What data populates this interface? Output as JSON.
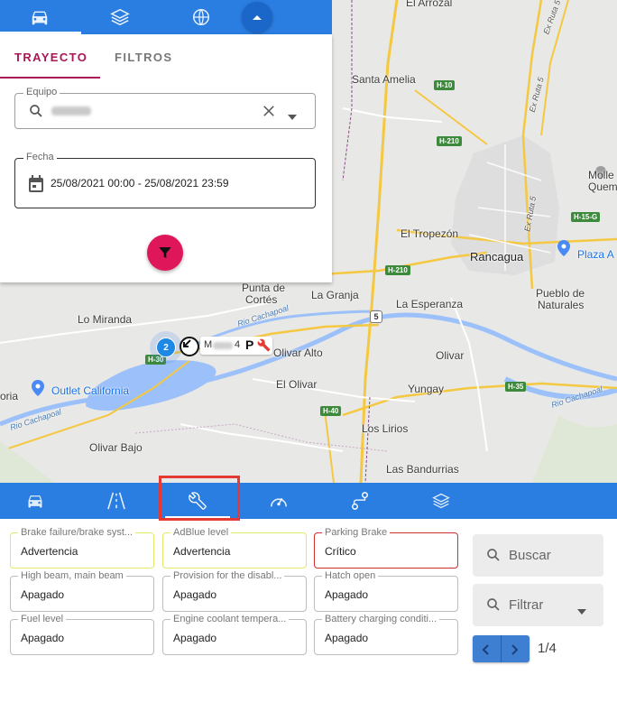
{
  "map": {
    "labels": {
      "el_arrozal": "El Arrozal",
      "santa_amelia": "Santa Amelia",
      "el_tropezon": "El Tropezón",
      "rancagua": "Rancagua",
      "plaza": "Plaza A",
      "punta_cortes_1": "Punta de",
      "punta_cortes_2": "Cortés",
      "la_granja": "La Granja",
      "la_esperanza": "La Esperanza",
      "pueblo_1": "Pueblo de",
      "pueblo_2": "Naturales",
      "lo_miranda": "Lo Miranda",
      "olivar_alto": "Olivar Alto",
      "olivar": "Olivar",
      "outlet": "Outlet California",
      "el_olivar": "El Olivar",
      "yungay": "Yungay",
      "los_lirios": "Los Lirios",
      "olivar_bajo": "Olivar Bajo",
      "las_bandurrias": "Las Bandurrias",
      "oria": "oria",
      "molle_1": "Molle",
      "molle_2": "Quem",
      "rio_1": "Rio Cachapoal",
      "rio_2": "Rio Cachapoal",
      "rio_3": "Rio Cachapoal",
      "ruta5_1": "Ex Ruta 5",
      "ruta5_2": "Ex Ruta 5",
      "ruta5_3": "Ex Ruta 5"
    },
    "shields": {
      "h10": "H-10",
      "h210a": "H-210",
      "h210b": "H-210",
      "h15g": "H-15-G",
      "h30": "H-30",
      "h40": "H-40",
      "h35": "H-35",
      "r5": "5"
    },
    "cluster_count": "2",
    "vehicle_label_suffix": "4",
    "vehicle_p": "P"
  },
  "panel": {
    "tabs": [
      "TRAYECTO",
      "FILTROS"
    ],
    "equipo_label": "Equipo",
    "fecha_label": "Fecha",
    "fecha_value": "25/08/2021 00:00 - 25/08/2021 23:59"
  },
  "cards": [
    {
      "title": "Brake failure/brake syst...",
      "value": "Advertencia",
      "status": "yellow"
    },
    {
      "title": "AdBlue level",
      "value": "Advertencia",
      "status": "yellow"
    },
    {
      "title": "Parking Brake",
      "value": "Crítico",
      "status": "red"
    },
    {
      "title": "High beam, main beam",
      "value": "Apagado",
      "status": "none"
    },
    {
      "title": "Provision for the disabl...",
      "value": "Apagado",
      "status": "none"
    },
    {
      "title": "Hatch open",
      "value": "Apagado",
      "status": "none"
    },
    {
      "title": "Fuel level",
      "value": "Apagado",
      "status": "none"
    },
    {
      "title": "Engine coolant tempera...",
      "value": "Apagado",
      "status": "none"
    },
    {
      "title": "Battery charging conditi...",
      "value": "Apagado",
      "status": "none"
    }
  ],
  "side": {
    "search_label": "Buscar",
    "filter_label": "Filtrar",
    "page_info": "1/4"
  },
  "colors": {
    "primary": "#2a7de1",
    "accent": "#ad1457",
    "fab": "#e0165a",
    "warning_border": "#e3e86b",
    "critical_border": "#d32f2f"
  },
  "icons": {
    "topbar": [
      "car-icon",
      "layers-icon",
      "globe-icon",
      "chevron-up-icon"
    ],
    "tools": [
      "car-icon",
      "road-icon",
      "wrench-icon",
      "speedometer-icon",
      "route-icon",
      "layers-icon"
    ]
  }
}
